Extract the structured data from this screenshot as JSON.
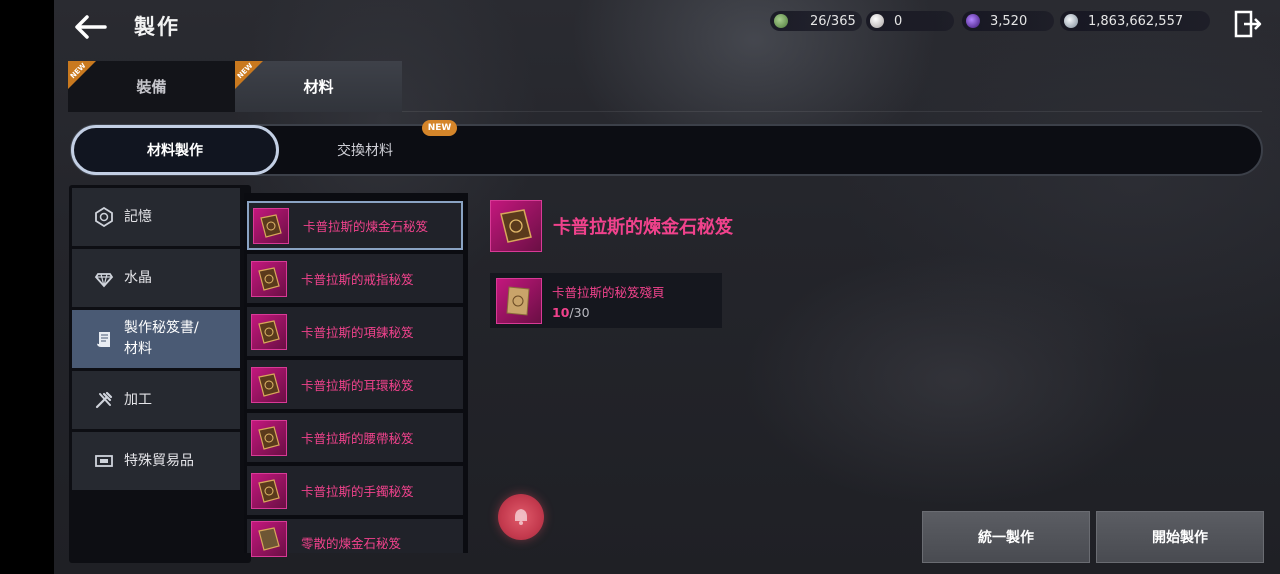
{
  "header": {
    "title": "製作",
    "back_icon": "arrow-left-icon",
    "exit_icon": "exit-door-icon"
  },
  "currencies": [
    {
      "name": "stamina",
      "icon": "green-gem-icon",
      "value": "26/365",
      "color": "#7fa46a"
    },
    {
      "name": "pearl",
      "icon": "pearl-icon",
      "value": "0",
      "color": "#d8d4d4"
    },
    {
      "name": "crystal",
      "icon": "purple-orb-icon",
      "value": "3,520",
      "color": "#6a2fb8"
    },
    {
      "name": "silver",
      "icon": "silver-coin-icon",
      "value": "1,863,662,557",
      "color": "#b8c2cc"
    }
  ],
  "top_tabs": [
    {
      "label": "裝備",
      "active": false,
      "badge": "NEW"
    },
    {
      "label": "材料",
      "active": true,
      "badge": "NEW"
    }
  ],
  "sub_tabs": [
    {
      "label": "材料製作",
      "active": true
    },
    {
      "label": "交換材料",
      "active": false,
      "badge": "NEW"
    }
  ],
  "categories": [
    {
      "label": "記憶",
      "icon": "memory-icon",
      "active": false
    },
    {
      "label": "水晶",
      "icon": "crystal-icon",
      "active": false
    },
    {
      "label": "製作秘笈書/材料",
      "line1": "製作秘笈書/",
      "line2": "材料",
      "icon": "scroll-icon",
      "active": true
    },
    {
      "label": "加工",
      "icon": "tools-icon",
      "active": false
    },
    {
      "label": "特殊貿易品",
      "icon": "trade-goods-icon",
      "active": false
    }
  ],
  "recipes": [
    {
      "label": "卡普拉斯的煉金石秘笈",
      "selected": true
    },
    {
      "label": "卡普拉斯的戒指秘笈",
      "selected": false
    },
    {
      "label": "卡普拉斯的項鍊秘笈",
      "selected": false
    },
    {
      "label": "卡普拉斯的耳環秘笈",
      "selected": false
    },
    {
      "label": "卡普拉斯的腰帶秘笈",
      "selected": false
    },
    {
      "label": "卡普拉斯的手鐲秘笈",
      "selected": false
    },
    {
      "label": "零散的煉金石秘笈",
      "selected": false
    }
  ],
  "detail": {
    "title": "卡普拉斯的煉金石秘笈",
    "icon": "book-icon",
    "materials": [
      {
        "name": "卡普拉斯的秘笈殘頁",
        "icon": "torn-page-icon",
        "have": "10",
        "separator": "/",
        "need": "30"
      }
    ]
  },
  "actions": {
    "batch_craft": "統一製作",
    "start_craft": "開始製作"
  },
  "colors": {
    "accent_pink": "#f0428c",
    "badge_orange": "#d5852a",
    "active_category": "#4a5a74"
  }
}
